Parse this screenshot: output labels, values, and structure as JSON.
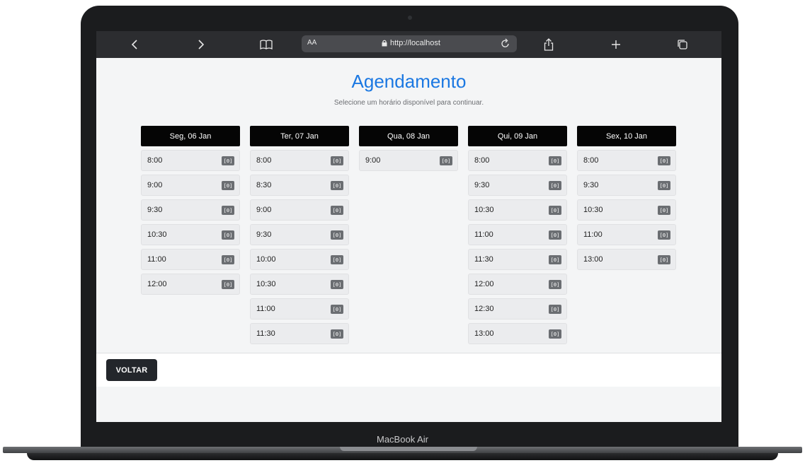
{
  "browser": {
    "text_size_label": "AA",
    "url": "http://localhost"
  },
  "page": {
    "title": "Agendamento",
    "subtitle": "Selecione um horário disponível para continuar."
  },
  "days": [
    {
      "label": "Seg, 06 Jan",
      "slots": [
        {
          "time": "8:00",
          "badge": "[0]"
        },
        {
          "time": "9:00",
          "badge": "[0]"
        },
        {
          "time": "9:30",
          "badge": "[0]"
        },
        {
          "time": "10:30",
          "badge": "[0]"
        },
        {
          "time": "11:00",
          "badge": "[0]"
        },
        {
          "time": "12:00",
          "badge": "[0]"
        }
      ]
    },
    {
      "label": "Ter, 07 Jan",
      "slots": [
        {
          "time": "8:00",
          "badge": "[0]"
        },
        {
          "time": "8:30",
          "badge": "[0]"
        },
        {
          "time": "9:00",
          "badge": "[0]"
        },
        {
          "time": "9:30",
          "badge": "[0]"
        },
        {
          "time": "10:00",
          "badge": "[0]"
        },
        {
          "time": "10:30",
          "badge": "[0]"
        },
        {
          "time": "11:00",
          "badge": "[0]"
        },
        {
          "time": "11:30",
          "badge": "[0]"
        }
      ]
    },
    {
      "label": "Qua, 08 Jan",
      "slots": [
        {
          "time": "9:00",
          "badge": "[0]"
        }
      ]
    },
    {
      "label": "Qui, 09 Jan",
      "slots": [
        {
          "time": "8:00",
          "badge": "[0]"
        },
        {
          "time": "9:30",
          "badge": "[0]"
        },
        {
          "time": "10:30",
          "badge": "[0]"
        },
        {
          "time": "11:00",
          "badge": "[0]"
        },
        {
          "time": "11:30",
          "badge": "[0]"
        },
        {
          "time": "12:00",
          "badge": "[0]"
        },
        {
          "time": "12:30",
          "badge": "[0]"
        },
        {
          "time": "13:00",
          "badge": "[0]"
        }
      ]
    },
    {
      "label": "Sex, 10 Jan",
      "slots": [
        {
          "time": "8:00",
          "badge": "[0]"
        },
        {
          "time": "9:30",
          "badge": "[0]"
        },
        {
          "time": "10:30",
          "badge": "[0]"
        },
        {
          "time": "11:00",
          "badge": "[0]"
        },
        {
          "time": "13:00",
          "badge": "[0]"
        }
      ]
    }
  ],
  "footer": {
    "back_label": "VOLTAR"
  },
  "device": {
    "label": "MacBook Air"
  },
  "colors": {
    "accent": "#1b78e2",
    "header_bg": "#050505",
    "back_button": "#23262b"
  },
  "icons": [
    "back-icon",
    "forward-icon",
    "bookmarks-icon",
    "lock-icon",
    "reload-icon",
    "share-icon",
    "new-tab-icon",
    "tabs-icon"
  ]
}
